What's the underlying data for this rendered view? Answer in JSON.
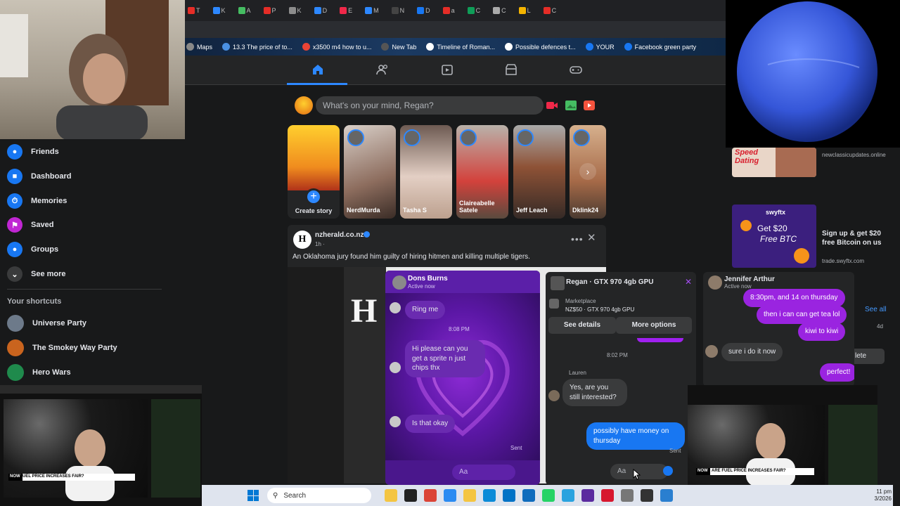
{
  "browser": {
    "tab_fragments": [
      "T",
      "K",
      "A",
      "P",
      "K",
      "D",
      "E",
      "M",
      "N",
      "D",
      "a",
      "C",
      "C",
      "L",
      "C"
    ],
    "bookmarks": [
      "Maps",
      "13.3 The price of to...",
      "x3500 m4 how to u...",
      "New Tab",
      "Timeline of Roman...",
      "Possible defences t...",
      "YOUR",
      "Facebook green party"
    ]
  },
  "composer": {
    "placeholder": "What's on your mind, Regan?"
  },
  "sidebar": {
    "items": [
      {
        "label": "Friends",
        "icon": "friends-icon"
      },
      {
        "label": "Dashboard",
        "icon": "dashboard-icon"
      },
      {
        "label": "Memories",
        "icon": "memories-icon"
      },
      {
        "label": "Saved",
        "icon": "saved-icon"
      },
      {
        "label": "Groups",
        "icon": "groups-icon"
      },
      {
        "label": "See more",
        "icon": "chevron-down-icon"
      }
    ],
    "shortcuts_heading": "Your shortcuts",
    "shortcuts": [
      "Universe Party",
      "The Smokey Way Party",
      "Hero Wars"
    ]
  },
  "stories": [
    {
      "label": "Create story"
    },
    {
      "label": "NerdMurda"
    },
    {
      "label": "Tasha S"
    },
    {
      "label": "Claireabelle Satele"
    },
    {
      "label": "Jeff Leach"
    },
    {
      "label": "Dklink24"
    }
  ],
  "post": {
    "author": "nzherald.co.nz",
    "time": "1h · ",
    "text": "An Oklahoma jury found him guilty of hiring hitmen and killing multiple tigers."
  },
  "ads": {
    "ad1": {
      "banner": "Speed Dating",
      "domain": "newclassicupdates.online"
    },
    "ad2": {
      "brand": "swyftx",
      "headline_1": "Get $20",
      "headline_2": "Free BTC",
      "title": "Sign up & get $20 free Bitcoin on us",
      "domain": "trade.swyftx.com"
    },
    "see_all": "See all",
    "right_misc_1": "4d",
    "right_misc_2": "lete"
  },
  "chat1": {
    "name": "Dons Burns",
    "status": "Active now",
    "messages": [
      {
        "from": "them",
        "text": "Ring me"
      },
      {
        "time": "8:08 PM"
      },
      {
        "from": "them",
        "text": "Hi please can you get a sprite n just chips thx"
      },
      {
        "from": "them",
        "text": "Is that okay"
      }
    ],
    "sent": "Sent",
    "input_placeholder": "Aa"
  },
  "chat2": {
    "name": "Regan · GTX 970 4gb GPU",
    "marketplace_label": "Marketplace",
    "listing": "NZ$50 · GTX 970 4gb GPU",
    "see_details": "See details",
    "more_options": "More options",
    "time": "8:02 PM",
    "sender_name": "Lauren",
    "message_1": "Yes, are you still interested?",
    "message_2": "possibly have money on thursday",
    "sent": "Sent",
    "input_placeholder": "Aa"
  },
  "chat3": {
    "name": "Jennifer Arthur",
    "status": "Active now",
    "msg_1": "8:30pm, and 14 on thursday",
    "msg_2": "then i can can get tea lol",
    "msg_3": "kiwi to kiwi",
    "msg_4": "sure i do it now",
    "msg_5": "perfect!"
  },
  "webinar": {
    "banner": "ARE FUEL PRICE INCREASES FAIR?",
    "now": "NOW"
  },
  "taskbar": {
    "search_label": "Search",
    "time": "11 pm",
    "date": "3/2026"
  },
  "colors": {
    "fb_blue": "#2d88ff",
    "messenger_purple": "#7a26d8",
    "bg": "#18191a",
    "card": "#242526"
  }
}
